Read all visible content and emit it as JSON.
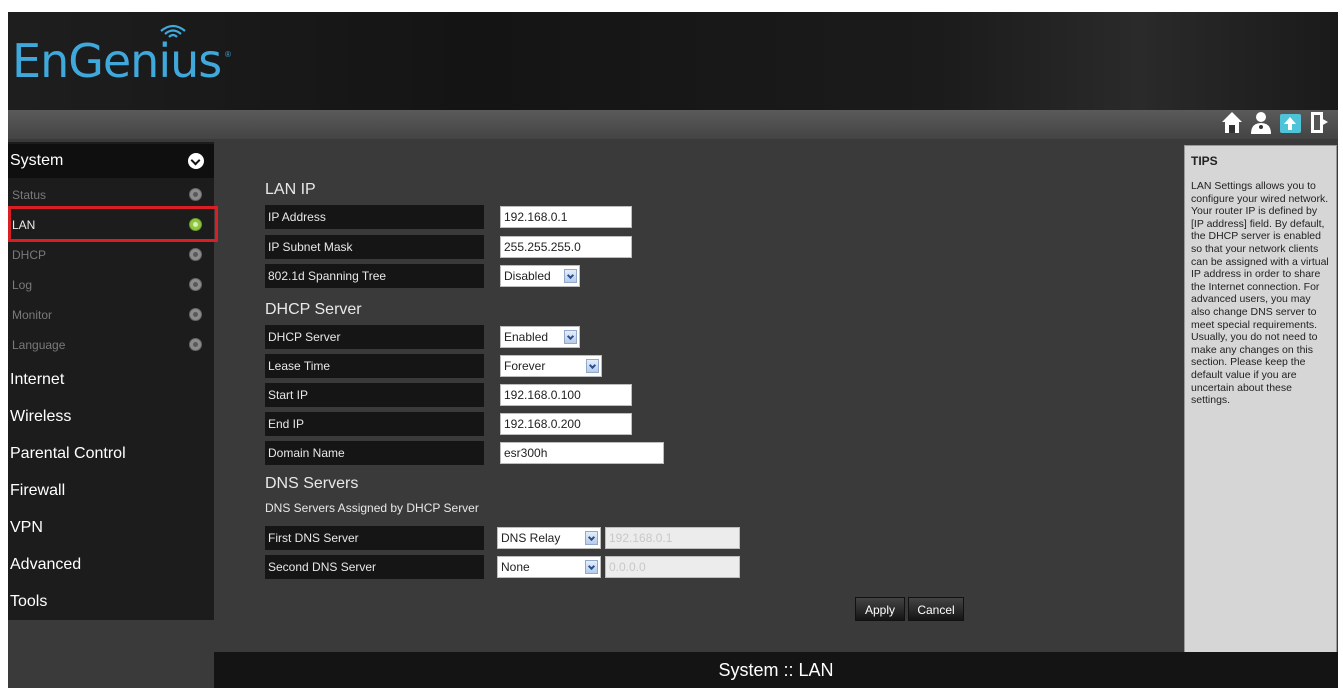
{
  "brand": {
    "name": "EnGenius",
    "reg": "®"
  },
  "top_icons": [
    "home-icon",
    "user-icon",
    "wizard-icon",
    "logout-icon"
  ],
  "sidebar": {
    "system": {
      "label": "System"
    },
    "sub_items": [
      {
        "label": "Status",
        "active": false
      },
      {
        "label": "LAN",
        "active": true
      },
      {
        "label": "DHCP",
        "active": false
      },
      {
        "label": "Log",
        "active": false
      },
      {
        "label": "Monitor",
        "active": false
      },
      {
        "label": "Language",
        "active": false
      }
    ],
    "main_items": [
      "Internet",
      "Wireless",
      "Parental Control",
      "Firewall",
      "VPN",
      "Advanced",
      "Tools"
    ]
  },
  "lan_ip": {
    "title": "LAN IP",
    "ip_address": {
      "label": "IP Address",
      "value": "192.168.0.1"
    },
    "subnet_mask": {
      "label": "IP Subnet Mask",
      "value": "255.255.255.0"
    },
    "spanning_tree": {
      "label": "802.1d Spanning Tree",
      "value": "Disabled"
    }
  },
  "dhcp_server": {
    "title": "DHCP Server",
    "server": {
      "label": "DHCP Server",
      "value": "Enabled"
    },
    "lease_time": {
      "label": "Lease Time",
      "value": "Forever"
    },
    "start_ip": {
      "label": "Start IP",
      "value": "192.168.0.100"
    },
    "end_ip": {
      "label": "End IP",
      "value": "192.168.0.200"
    },
    "domain_name": {
      "label": "Domain Name",
      "value": "esr300h"
    }
  },
  "dns_servers": {
    "title": "DNS Servers",
    "note": "DNS Servers Assigned by DHCP Server",
    "first": {
      "label": "First DNS Server",
      "value": "DNS Relay",
      "ip": "192.168.0.1"
    },
    "second": {
      "label": "Second DNS Server",
      "value": "None",
      "ip": "0.0.0.0"
    }
  },
  "buttons": {
    "apply": "Apply",
    "cancel": "Cancel"
  },
  "tips": {
    "title": "TIPS",
    "body": "LAN Settings allows you to configure your wired network. Your router IP is defined by [IP address] field. By default, the DHCP server is enabled so that your network clients can be assigned with a virtual IP address in order to share the Internet connection. For advanced users, you may also change DNS server to meet special requirements. Usually, you do not need to make any changes on this section. Please keep the default value if you are uncertain about these settings."
  },
  "footer": {
    "title": "System :: LAN"
  },
  "colors": {
    "accent": "#3fa9dc",
    "highlight": "#d81f26",
    "active_dot": "#8ec63f"
  }
}
